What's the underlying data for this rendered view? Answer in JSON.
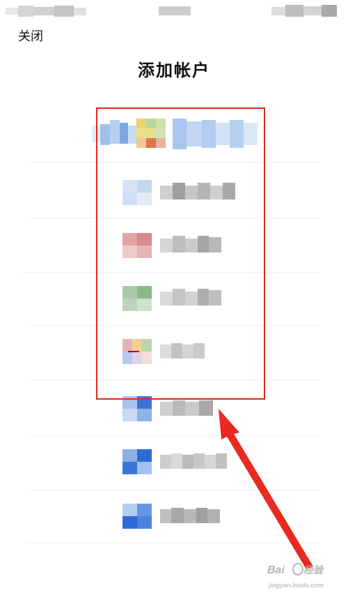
{
  "header": {
    "close_label": "关闭",
    "title": "添加帐户"
  },
  "accounts": [
    {
      "name": "account-row-1",
      "icon": "account-provider-icon",
      "color": "#9bbfe8"
    },
    {
      "name": "account-row-2",
      "icon": "account-provider-icon",
      "color": "#c8d9ef"
    },
    {
      "name": "account-row-3",
      "icon": "account-provider-icon",
      "color": "#d99090"
    },
    {
      "name": "account-row-4",
      "icon": "account-provider-icon",
      "color": "#8fb88f"
    },
    {
      "name": "account-row-5",
      "icon": "account-provider-icon",
      "color": "#d8a0a0"
    },
    {
      "name": "account-row-6",
      "icon": "account-provider-icon",
      "color": "#3a76d8"
    },
    {
      "name": "account-row-7",
      "icon": "account-provider-icon",
      "color": "#3a76d8"
    },
    {
      "name": "account-row-8",
      "icon": "account-provider-icon",
      "color": "#3a76d8"
    }
  ],
  "annotation": {
    "box_color": "#e0281f",
    "arrow_color": "#e82a20"
  }
}
